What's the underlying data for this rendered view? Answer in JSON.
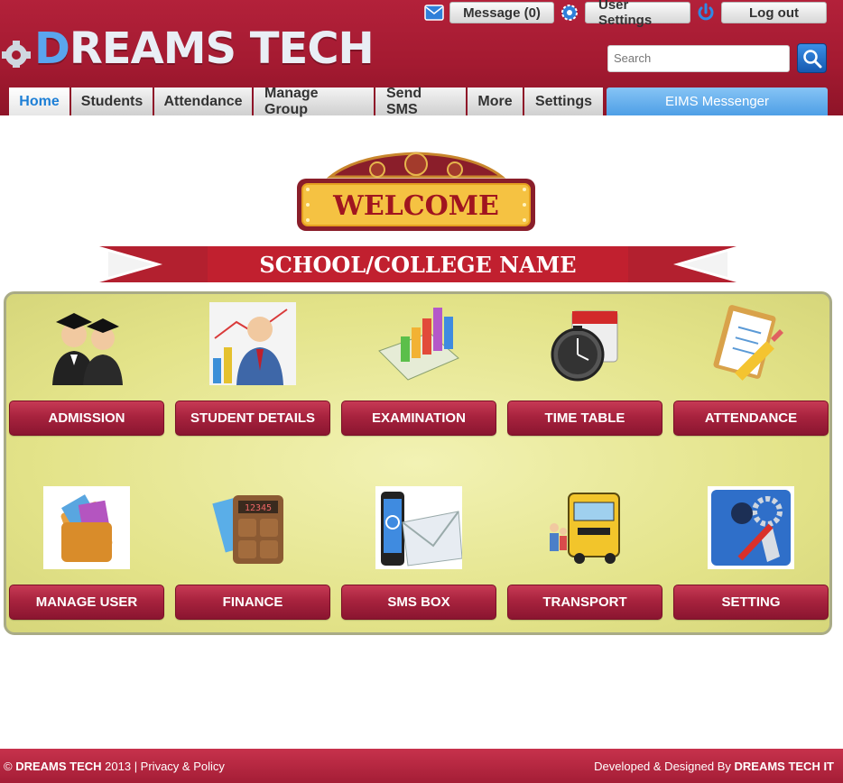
{
  "brand": {
    "logo_text_colored": "D",
    "logo_text": "REAMS TECH"
  },
  "topbar": {
    "message_label": "Message (0)",
    "user_settings_label": "User Settings",
    "logout_label": "Log out"
  },
  "search": {
    "placeholder": "Search"
  },
  "nav": {
    "items": [
      {
        "label": "Home"
      },
      {
        "label": "Students"
      },
      {
        "label": "Attendance"
      },
      {
        "label": "Manage Group"
      },
      {
        "label": "Send SMS"
      },
      {
        "label": "More"
      },
      {
        "label": "Settings"
      }
    ],
    "messenger_label": "EIMS Messenger"
  },
  "welcome": {
    "title": "WELCOME",
    "school_name": "SCHOOL/COLLEGE NAME"
  },
  "modules": [
    {
      "label": "ADMISSION",
      "icon": "graduates-icon"
    },
    {
      "label": "STUDENT DETAILS",
      "icon": "businessman-chart-icon"
    },
    {
      "label": "EXAMINATION",
      "icon": "bar-chart-icon"
    },
    {
      "label": "TIME TABLE",
      "icon": "stopwatch-calendar-icon"
    },
    {
      "label": "ATTENDANCE",
      "icon": "clipboard-pencil-icon"
    },
    {
      "label": "MANAGE USER",
      "icon": "wallet-icon"
    },
    {
      "label": "FINANCE",
      "icon": "calculator-icon"
    },
    {
      "label": "SMS BOX",
      "icon": "phone-envelope-icon"
    },
    {
      "label": "TRANSPORT",
      "icon": "school-bus-icon"
    },
    {
      "label": "SETTING",
      "icon": "settings-tools-icon"
    }
  ],
  "footer": {
    "copyright_prefix": "© ",
    "copyright_brand": "DREAMS TECH",
    "copyright_suffix": " 2013 | Privacy & Policy",
    "credit_prefix": "Developed & Designed By ",
    "credit_brand": "DREAMS TECH IT"
  },
  "colors": {
    "header": "#a41a31",
    "accent_blue": "#1d7fd6",
    "panel": "#e3e389",
    "button": "#a8233e"
  }
}
